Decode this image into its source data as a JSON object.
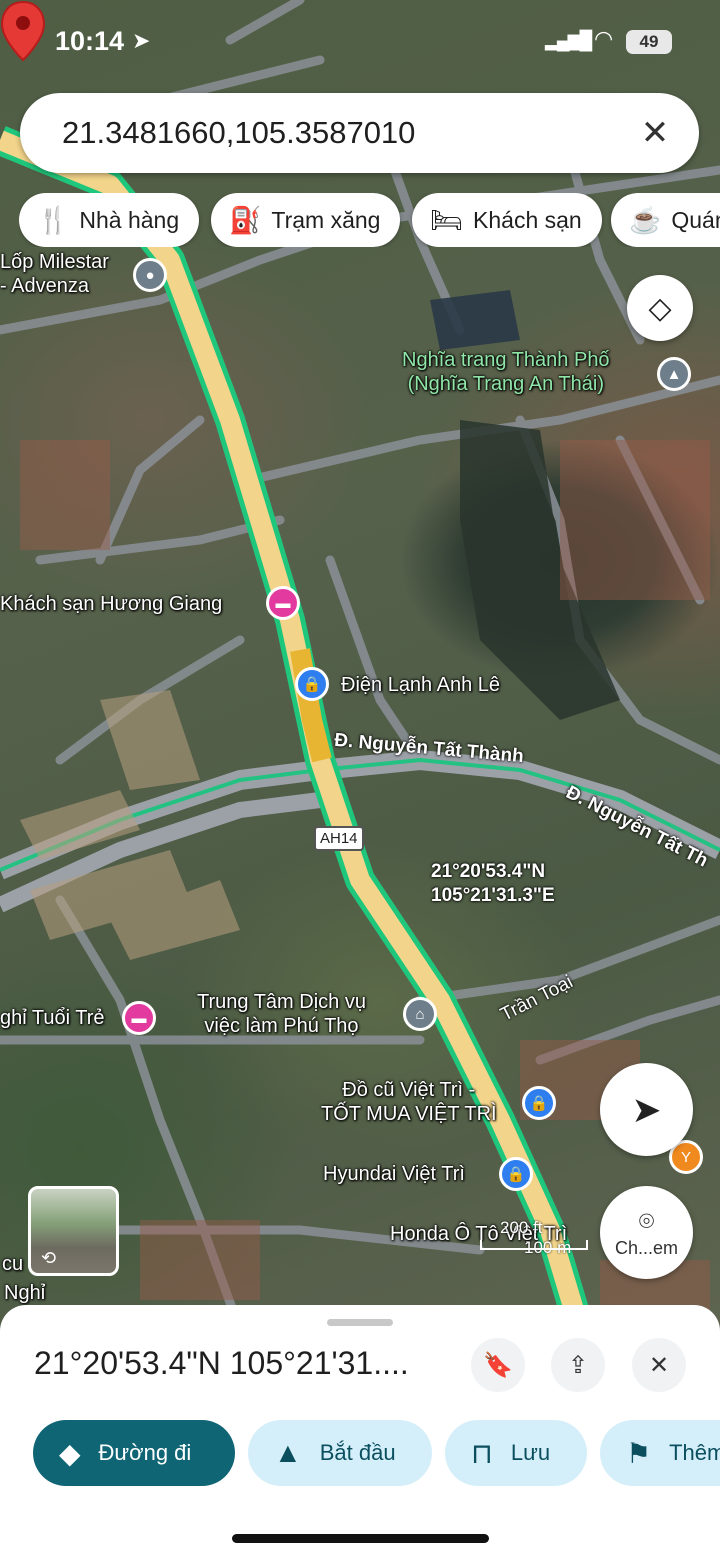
{
  "status_bar": {
    "time": "10:14",
    "battery": "49"
  },
  "search": {
    "query": "21.3481660,105.3587010"
  },
  "chips": [
    {
      "icon": "restaurant-icon",
      "label": "Nhà hàng"
    },
    {
      "icon": "gas-station-icon",
      "label": "Trạm xăng"
    },
    {
      "icon": "hotel-icon",
      "label": "Khách sạn"
    },
    {
      "icon": "cafe-icon",
      "label": "Quán"
    }
  ],
  "map": {
    "labels": {
      "milestar": "Lốp Milestar\n- Advenza",
      "cemetery": "Nghĩa trang Thành Phố\n(Nghĩa Trang An Thái)",
      "huong_giang": "Khách sạn Hương Giang",
      "anh_le": "Điện Lạnh Anh Lê",
      "road1": "Đ. Nguyễn Tất Thành",
      "road2": "Đ. Nguyễn Tất Th",
      "route": "AH14",
      "coord_lat": "21°20'53.4\"N",
      "coord_lng": "105°21'31.3\"E",
      "tuoi_tre": "ghỉ Tuổi Trẻ",
      "trung_tam": "Trung Tâm Dịch vụ\nviệc làm Phú Thọ",
      "do_cu": "Đồ cũ Việt Trì -\nTỐT MUA VIỆT TRÌ",
      "tran_toai": "Trần Toại",
      "hyundai": "Hyundai Việt Trì",
      "honda": "Honda Ô Tô Việt Trì",
      "cu": "cu",
      "nghi": "Nghỉ"
    },
    "scale": {
      "top": "200 ft",
      "bottom": "100 m"
    },
    "lens_label": "Ch...em"
  },
  "sheet": {
    "title": "21°20'53.4\"N 105°21'31....",
    "actions": [
      {
        "icon": "directions-icon",
        "label": "Đường đi"
      },
      {
        "icon": "navigation-arrow-icon",
        "label": "Bắt đầu"
      },
      {
        "icon": "bookmark-icon",
        "label": "Lưu"
      },
      {
        "icon": "flag-icon",
        "label": "Thêm"
      }
    ]
  },
  "colors": {
    "primary_action": "#0f6574",
    "secondary_action": "#d4effa",
    "route_green": "#1fc77c",
    "highway_yellow": "#f2d48a",
    "marker_red": "#e53935"
  }
}
